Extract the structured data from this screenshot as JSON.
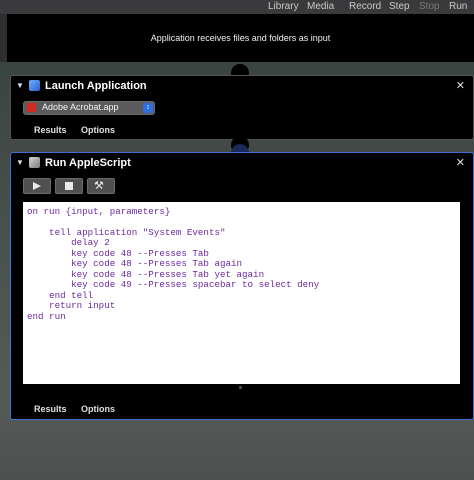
{
  "toolbar": {
    "library": "Library",
    "media": "Media",
    "record": "Record",
    "step": "Step",
    "stop": "Stop",
    "run": "Run"
  },
  "workflow": {
    "input_message": "Application receives files and folders as input"
  },
  "launch_app": {
    "title": "Launch Application",
    "selected_app": "Adobe Acrobat.app",
    "tabs": {
      "results": "Results",
      "options": "Options"
    }
  },
  "run_applescript": {
    "title": "Run AppleScript",
    "script_lines": [
      "on run {input, parameters}",
      "",
      "    tell application \"System Events\"",
      "        delay 2",
      "        key code 48 --Presses Tab",
      "        key code 48 --Presses Tab again",
      "        key code 48 --Presses Tab yet again",
      "        key code 49 --Presses spacebar to select deny",
      "    end tell",
      "    return input",
      "end run"
    ],
    "tabs": {
      "results": "Results",
      "options": "Options"
    }
  },
  "icons": {
    "close": "close-icon",
    "collapse": "chevron-down-icon",
    "run": "play-icon",
    "stop": "stop-icon",
    "compile": "hammer-icon"
  }
}
